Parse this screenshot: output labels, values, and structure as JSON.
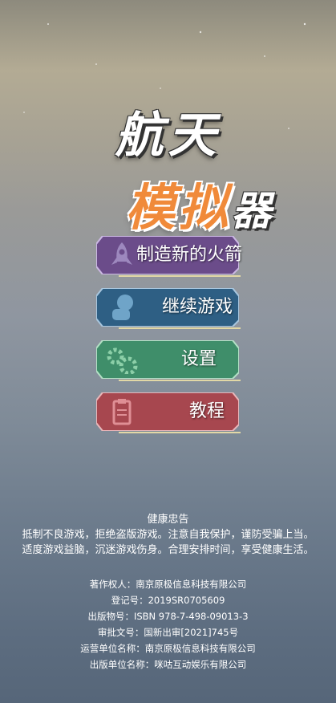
{
  "title": {
    "line1": "航天",
    "line2_main": "模拟",
    "line2_tail": "器"
  },
  "menu": [
    {
      "label": "制造新的火箭",
      "icon": "rocket-icon",
      "color": "#6b4c8a"
    },
    {
      "label": "继续游戏",
      "icon": "astronaut-icon",
      "color": "#2e5f84"
    },
    {
      "label": "设置",
      "icon": "gear-icon",
      "color": "#3f8e6a"
    },
    {
      "label": "教程",
      "icon": "clipboard-icon",
      "color": "#a7474f"
    }
  ],
  "health": {
    "title": "健康忠告",
    "line1": "抵制不良游戏，拒绝盗版游戏。注意自我保护，谨防受骗上当。",
    "line2": "适度游戏益脑，沉迷游戏伤身。合理安排时间，享受健康生活。"
  },
  "info": [
    "著作权人：南京原极信息科技有限公司",
    "登记号：2019SR0705609",
    "出版物号：ISBN 978-7-498-09013-3",
    "审批文号：国新出审[2021]745号",
    "运营单位名称：南京原极信息科技有限公司",
    "出版单位名称：咪咕互动娱乐有限公司"
  ]
}
